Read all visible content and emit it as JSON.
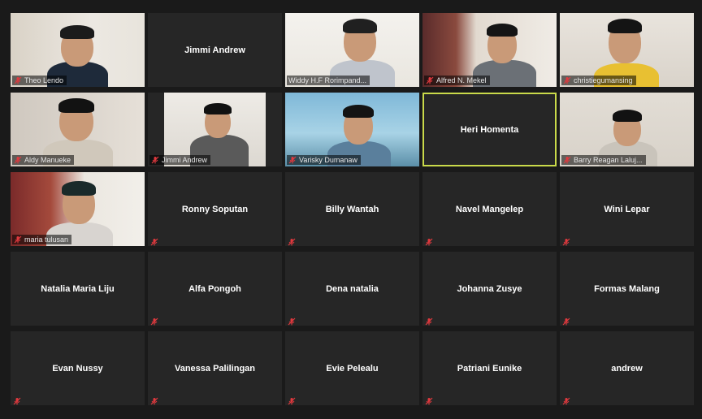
{
  "tiles": [
    {
      "name": "Theo Lendo",
      "video": true,
      "muted": true
    },
    {
      "name": "Jimmi Andrew",
      "video": false,
      "muted": false
    },
    {
      "name": "Widdy H.F Rorimpand...",
      "video": true,
      "muted": false
    },
    {
      "name": "Alfred N. Mekel",
      "video": true,
      "muted": true
    },
    {
      "name": "christiegumansing",
      "video": true,
      "muted": true
    },
    {
      "name": "Aldy Manueke",
      "video": true,
      "muted": true
    },
    {
      "name": "Jimmi Andrew",
      "video": true,
      "muted": true
    },
    {
      "name": "Varisky Dumanaw",
      "video": true,
      "muted": true
    },
    {
      "name": "Heri Homenta",
      "video": false,
      "muted": false,
      "active": true
    },
    {
      "name": "Barry Reagan Laluj...",
      "video": true,
      "muted": true
    },
    {
      "name": "maria tulusan",
      "video": true,
      "muted": true
    },
    {
      "name": "Ronny Soputan",
      "video": false,
      "muted": true
    },
    {
      "name": "Billy Wantah",
      "video": false,
      "muted": true
    },
    {
      "name": "Navel Mangelep",
      "video": false,
      "muted": true
    },
    {
      "name": "Wini Lepar",
      "video": false,
      "muted": true
    },
    {
      "name": "Natalia Maria Liju",
      "video": false,
      "muted": false
    },
    {
      "name": "Alfa Pongoh",
      "video": false,
      "muted": true
    },
    {
      "name": "Dena natalia",
      "video": false,
      "muted": true
    },
    {
      "name": "Johanna Zusye",
      "video": false,
      "muted": true
    },
    {
      "name": "Formas Malang",
      "video": false,
      "muted": true
    },
    {
      "name": "Evan Nussy",
      "video": false,
      "muted": true
    },
    {
      "name": "Vanessa Palilingan",
      "video": false,
      "muted": true
    },
    {
      "name": "Evie Pelealu",
      "video": false,
      "muted": true
    },
    {
      "name": "Patriani Eunike",
      "video": false,
      "muted": true
    },
    {
      "name": "andrew",
      "video": false,
      "muted": true
    }
  ],
  "colors": {
    "background": "#1a1a1a",
    "tile": "#262626",
    "active_border": "#c9d94a",
    "mute_icon": "#e0393e"
  },
  "icons": {
    "mute": "muted-microphone-icon"
  }
}
